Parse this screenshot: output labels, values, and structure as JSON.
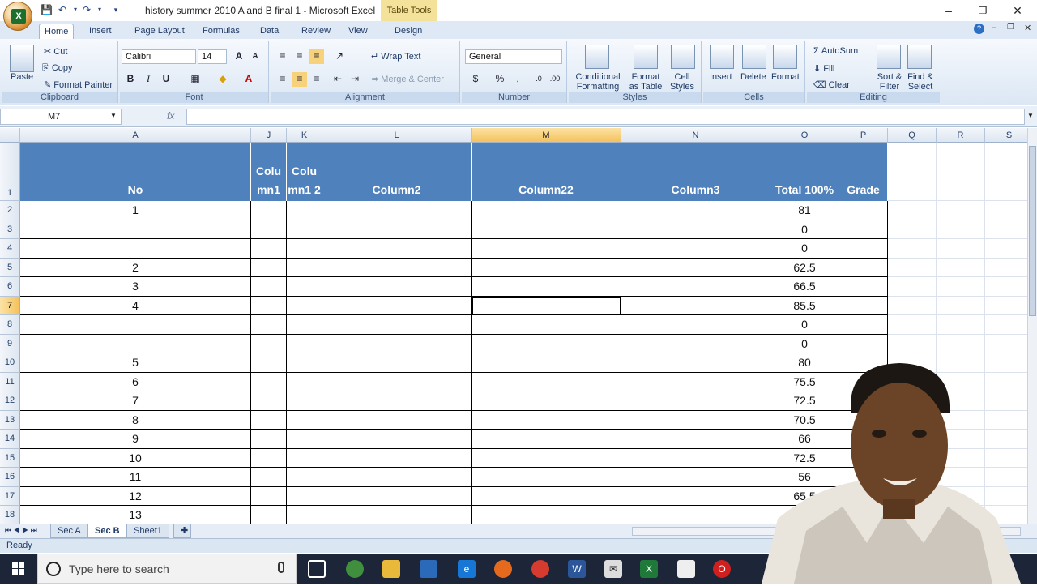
{
  "window": {
    "title": "history summer 2010  A and B final 1 - Microsoft Excel",
    "context_tab": "Table Tools"
  },
  "ribbon_tabs": [
    "Home",
    "Insert",
    "Page Layout",
    "Formulas",
    "Data",
    "Review",
    "View",
    "Design"
  ],
  "clipboard": {
    "paste": "Paste",
    "cut": "Cut",
    "copy": "Copy",
    "format_painter": "Format Painter",
    "label": "Clipboard"
  },
  "font": {
    "name": "Calibri",
    "size": "14",
    "label": "Font",
    "bold": "B",
    "italic": "I",
    "underline": "U"
  },
  "alignment": {
    "wrap": "Wrap Text",
    "merge": "Merge & Center",
    "label": "Alignment"
  },
  "number": {
    "format": "General",
    "currency": "$",
    "percent": "%",
    "comma": ",",
    "label": "Number"
  },
  "styles": {
    "conditional": "Conditional",
    "conditional2": "Formatting",
    "format_table": "Format",
    "format_table2": "as Table",
    "cell_styles": "Cell",
    "cell_styles2": "Styles",
    "label": "Styles"
  },
  "cells": {
    "insert": "Insert",
    "delete": "Delete",
    "format": "Format",
    "label": "Cells"
  },
  "editing": {
    "autosum": "AutoSum",
    "fill": "Fill",
    "clear": "Clear",
    "sort": "Sort &",
    "sort2": "Filter",
    "find": "Find &",
    "find2": "Select",
    "label": "Editing"
  },
  "formula_bar": {
    "name_box": "M7",
    "fx": "fx",
    "content": ""
  },
  "columns": [
    {
      "letter": "A",
      "header": "No"
    },
    {
      "letter": "J",
      "header": "Colu mn1"
    },
    {
      "letter": "K",
      "header": "Colu mn1 2"
    },
    {
      "letter": "L",
      "header": "Column2"
    },
    {
      "letter": "M",
      "header": "Column22"
    },
    {
      "letter": "N",
      "header": "Column3"
    },
    {
      "letter": "O",
      "header": "Total 100%"
    },
    {
      "letter": "P",
      "header": "Grade"
    },
    {
      "letter": "Q",
      "header": ""
    },
    {
      "letter": "R",
      "header": ""
    },
    {
      "letter": "S",
      "header": ""
    }
  ],
  "selected_cell": {
    "column": "M",
    "row": 7
  },
  "rows": [
    {
      "row": 2,
      "no": "1",
      "total": "81"
    },
    {
      "row": 3,
      "no": "",
      "total": "0"
    },
    {
      "row": 4,
      "no": "",
      "total": "0"
    },
    {
      "row": 5,
      "no": "2",
      "total": "62.5"
    },
    {
      "row": 6,
      "no": "3",
      "total": "66.5"
    },
    {
      "row": 7,
      "no": "4",
      "total": "85.5"
    },
    {
      "row": 8,
      "no": "",
      "total": "0"
    },
    {
      "row": 9,
      "no": "",
      "total": "0"
    },
    {
      "row": 10,
      "no": "5",
      "total": "80"
    },
    {
      "row": 11,
      "no": "6",
      "total": "75.5"
    },
    {
      "row": 12,
      "no": "7",
      "total": "72.5"
    },
    {
      "row": 13,
      "no": "8",
      "total": "70.5"
    },
    {
      "row": 14,
      "no": "9",
      "total": "66"
    },
    {
      "row": 15,
      "no": "10",
      "total": "72.5"
    },
    {
      "row": 16,
      "no": "11",
      "total": "56"
    },
    {
      "row": 17,
      "no": "12",
      "total": "65.5"
    },
    {
      "row": 18,
      "no": "13",
      "total": "77"
    }
  ],
  "sheets": [
    "Sec A",
    "Sec B",
    "Sheet1"
  ],
  "active_sheet": "Sec B",
  "status": "Ready",
  "taskbar": {
    "search_placeholder": "Type here to search"
  },
  "colors": {
    "header_fill": "#4f81bd",
    "selected_header": "#f5c15a",
    "table_tools": "#f5e29a"
  }
}
